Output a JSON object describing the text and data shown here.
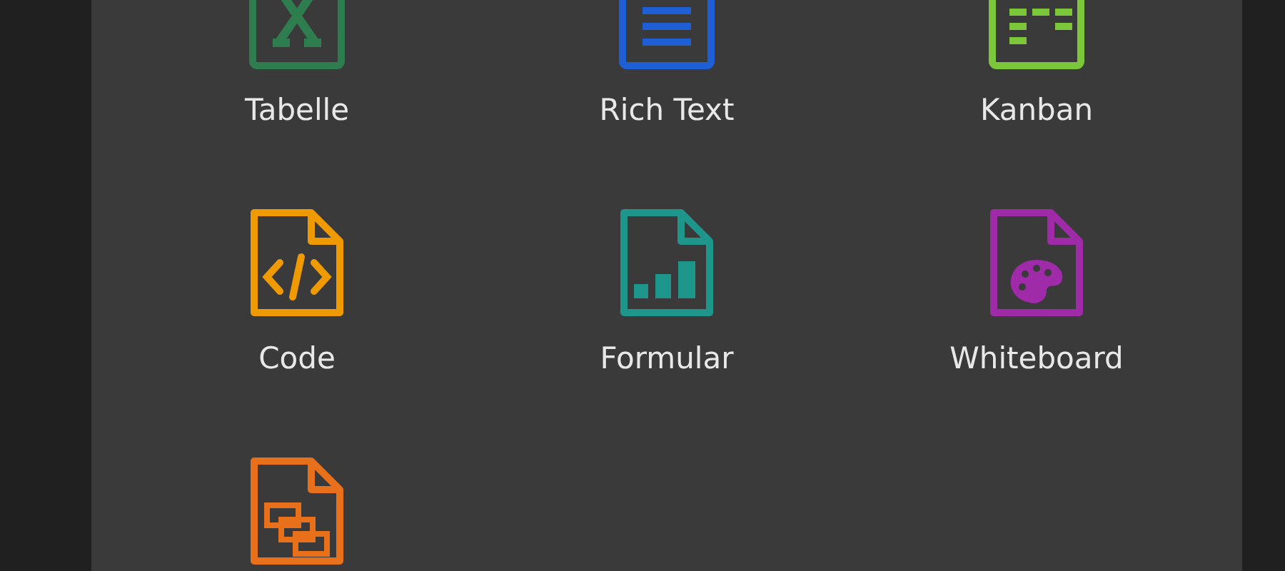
{
  "templates": [
    {
      "kind": "spreadsheet",
      "label": "Tabelle",
      "color": "#2e7d4f"
    },
    {
      "kind": "richtext",
      "label": "Rich Text",
      "color": "#1e5fd6"
    },
    {
      "kind": "kanban",
      "label": "Kanban",
      "color": "#7cc63a"
    },
    {
      "kind": "code",
      "label": "Code",
      "color": "#ee9a00"
    },
    {
      "kind": "form",
      "label": "Formular",
      "color": "#1f968b"
    },
    {
      "kind": "whiteboard",
      "label": "Whiteboard",
      "color": "#a02ba8"
    },
    {
      "kind": "diagram",
      "color": "#e8701a"
    }
  ]
}
